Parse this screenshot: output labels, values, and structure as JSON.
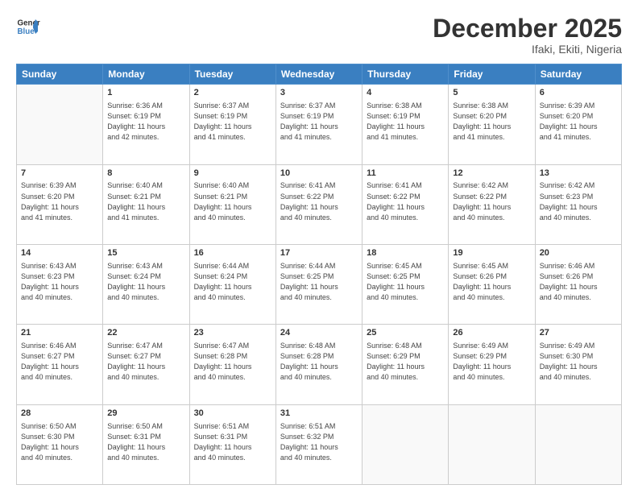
{
  "header": {
    "logo_general": "General",
    "logo_blue": "Blue",
    "month": "December 2025",
    "location": "Ifaki, Ekiti, Nigeria"
  },
  "days_of_week": [
    "Sunday",
    "Monday",
    "Tuesday",
    "Wednesday",
    "Thursday",
    "Friday",
    "Saturday"
  ],
  "weeks": [
    [
      {
        "day": "",
        "info": ""
      },
      {
        "day": "1",
        "info": "Sunrise: 6:36 AM\nSunset: 6:19 PM\nDaylight: 11 hours\nand 42 minutes."
      },
      {
        "day": "2",
        "info": "Sunrise: 6:37 AM\nSunset: 6:19 PM\nDaylight: 11 hours\nand 41 minutes."
      },
      {
        "day": "3",
        "info": "Sunrise: 6:37 AM\nSunset: 6:19 PM\nDaylight: 11 hours\nand 41 minutes."
      },
      {
        "day": "4",
        "info": "Sunrise: 6:38 AM\nSunset: 6:19 PM\nDaylight: 11 hours\nand 41 minutes."
      },
      {
        "day": "5",
        "info": "Sunrise: 6:38 AM\nSunset: 6:20 PM\nDaylight: 11 hours\nand 41 minutes."
      },
      {
        "day": "6",
        "info": "Sunrise: 6:39 AM\nSunset: 6:20 PM\nDaylight: 11 hours\nand 41 minutes."
      }
    ],
    [
      {
        "day": "7",
        "info": "Sunrise: 6:39 AM\nSunset: 6:20 PM\nDaylight: 11 hours\nand 41 minutes."
      },
      {
        "day": "8",
        "info": "Sunrise: 6:40 AM\nSunset: 6:21 PM\nDaylight: 11 hours\nand 41 minutes."
      },
      {
        "day": "9",
        "info": "Sunrise: 6:40 AM\nSunset: 6:21 PM\nDaylight: 11 hours\nand 40 minutes."
      },
      {
        "day": "10",
        "info": "Sunrise: 6:41 AM\nSunset: 6:22 PM\nDaylight: 11 hours\nand 40 minutes."
      },
      {
        "day": "11",
        "info": "Sunrise: 6:41 AM\nSunset: 6:22 PM\nDaylight: 11 hours\nand 40 minutes."
      },
      {
        "day": "12",
        "info": "Sunrise: 6:42 AM\nSunset: 6:22 PM\nDaylight: 11 hours\nand 40 minutes."
      },
      {
        "day": "13",
        "info": "Sunrise: 6:42 AM\nSunset: 6:23 PM\nDaylight: 11 hours\nand 40 minutes."
      }
    ],
    [
      {
        "day": "14",
        "info": "Sunrise: 6:43 AM\nSunset: 6:23 PM\nDaylight: 11 hours\nand 40 minutes."
      },
      {
        "day": "15",
        "info": "Sunrise: 6:43 AM\nSunset: 6:24 PM\nDaylight: 11 hours\nand 40 minutes."
      },
      {
        "day": "16",
        "info": "Sunrise: 6:44 AM\nSunset: 6:24 PM\nDaylight: 11 hours\nand 40 minutes."
      },
      {
        "day": "17",
        "info": "Sunrise: 6:44 AM\nSunset: 6:25 PM\nDaylight: 11 hours\nand 40 minutes."
      },
      {
        "day": "18",
        "info": "Sunrise: 6:45 AM\nSunset: 6:25 PM\nDaylight: 11 hours\nand 40 minutes."
      },
      {
        "day": "19",
        "info": "Sunrise: 6:45 AM\nSunset: 6:26 PM\nDaylight: 11 hours\nand 40 minutes."
      },
      {
        "day": "20",
        "info": "Sunrise: 6:46 AM\nSunset: 6:26 PM\nDaylight: 11 hours\nand 40 minutes."
      }
    ],
    [
      {
        "day": "21",
        "info": "Sunrise: 6:46 AM\nSunset: 6:27 PM\nDaylight: 11 hours\nand 40 minutes."
      },
      {
        "day": "22",
        "info": "Sunrise: 6:47 AM\nSunset: 6:27 PM\nDaylight: 11 hours\nand 40 minutes."
      },
      {
        "day": "23",
        "info": "Sunrise: 6:47 AM\nSunset: 6:28 PM\nDaylight: 11 hours\nand 40 minutes."
      },
      {
        "day": "24",
        "info": "Sunrise: 6:48 AM\nSunset: 6:28 PM\nDaylight: 11 hours\nand 40 minutes."
      },
      {
        "day": "25",
        "info": "Sunrise: 6:48 AM\nSunset: 6:29 PM\nDaylight: 11 hours\nand 40 minutes."
      },
      {
        "day": "26",
        "info": "Sunrise: 6:49 AM\nSunset: 6:29 PM\nDaylight: 11 hours\nand 40 minutes."
      },
      {
        "day": "27",
        "info": "Sunrise: 6:49 AM\nSunset: 6:30 PM\nDaylight: 11 hours\nand 40 minutes."
      }
    ],
    [
      {
        "day": "28",
        "info": "Sunrise: 6:50 AM\nSunset: 6:30 PM\nDaylight: 11 hours\nand 40 minutes."
      },
      {
        "day": "29",
        "info": "Sunrise: 6:50 AM\nSunset: 6:31 PM\nDaylight: 11 hours\nand 40 minutes."
      },
      {
        "day": "30",
        "info": "Sunrise: 6:51 AM\nSunset: 6:31 PM\nDaylight: 11 hours\nand 40 minutes."
      },
      {
        "day": "31",
        "info": "Sunrise: 6:51 AM\nSunset: 6:32 PM\nDaylight: 11 hours\nand 40 minutes."
      },
      {
        "day": "",
        "info": ""
      },
      {
        "day": "",
        "info": ""
      },
      {
        "day": "",
        "info": ""
      }
    ]
  ]
}
